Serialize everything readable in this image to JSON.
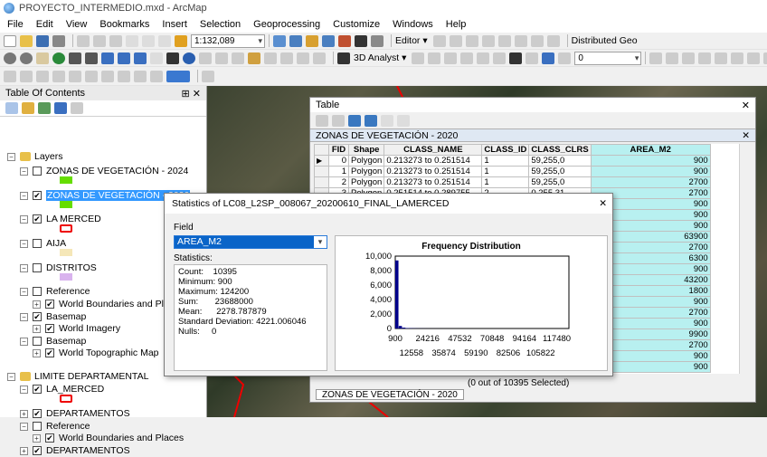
{
  "window": {
    "title": "PROYECTO_INTERMEDIO.mxd - ArcMap"
  },
  "menu": [
    "File",
    "Edit",
    "View",
    "Bookmarks",
    "Insert",
    "Selection",
    "Geoprocessing",
    "Customize",
    "Windows",
    "Help"
  ],
  "toolbar": {
    "scale": "1:132,089",
    "editor": "Editor ▾",
    "distributed": "Distributed Geo",
    "analyst": "3D Analyst ▾",
    "layer_combo_value": "0"
  },
  "toc": {
    "title": "Table Of Contents",
    "items": [
      {
        "label": "Layers",
        "level": 0,
        "pm": "−",
        "cb": false
      },
      {
        "label": "ZONAS DE VEGETACIÓN - 2024",
        "level": 1,
        "pm": "−",
        "cb": true,
        "checked": false
      },
      {
        "label": "ZONAS DE VEGETACIÓN - 2020",
        "level": 1,
        "pm": "−",
        "cb": true,
        "checked": true,
        "selected": true
      },
      {
        "label": "LA MERCED",
        "level": 1,
        "pm": "−",
        "cb": true,
        "checked": true
      },
      {
        "label": "AIJA",
        "level": 1,
        "pm": "−",
        "cb": true,
        "checked": false
      },
      {
        "label": "DISTRITOS",
        "level": 1,
        "pm": "−",
        "cb": true,
        "checked": false
      },
      {
        "label": "Reference",
        "level": 1,
        "pm": "−",
        "cb": true,
        "checked": false
      },
      {
        "label": "World Boundaries and Places",
        "level": 2,
        "pm": "+",
        "cb": true,
        "checked": true
      },
      {
        "label": "Basemap",
        "level": 1,
        "pm": "−",
        "cb": true,
        "checked": true
      },
      {
        "label": "World Imagery",
        "level": 2,
        "pm": "+",
        "cb": true,
        "checked": true
      },
      {
        "label": "Basemap",
        "level": 1,
        "pm": "−",
        "cb": true,
        "checked": false
      },
      {
        "label": "World Topographic Map",
        "level": 2,
        "pm": "+",
        "cb": true,
        "checked": true
      },
      {
        "label": "LIMITE DEPARTAMENTAL",
        "level": 0,
        "pm": "−",
        "cb": false
      },
      {
        "label": "LA_MERCED",
        "level": 1,
        "pm": "−",
        "cb": true,
        "checked": true
      },
      {
        "label": "DEPARTAMENTOS",
        "level": 1,
        "pm": "+",
        "cb": true,
        "checked": true
      },
      {
        "label": "Reference",
        "level": 1,
        "pm": "−",
        "cb": true,
        "checked": false
      },
      {
        "label": "World Boundaries and Places",
        "level": 2,
        "pm": "+",
        "cb": true,
        "checked": true
      },
      {
        "label": "DEPARTAMENTOS",
        "level": 1,
        "pm": "+",
        "cb": true,
        "checked": true
      }
    ]
  },
  "table": {
    "title": "Table",
    "layer_tab": "ZONAS DE VEGETACIÓN - 2020",
    "columns": [
      "",
      "FID",
      "Shape",
      "CLASS_NAME",
      "CLASS_ID",
      "CLASS_CLRS",
      "AREA_M2"
    ],
    "rows": [
      [
        "▶",
        "0",
        "Polygon",
        "0.213273 to 0.251514",
        "1",
        "59,255,0",
        "900"
      ],
      [
        "",
        "1",
        "Polygon",
        "0.213273 to 0.251514",
        "1",
        "59,255,0",
        "900"
      ],
      [
        "",
        "2",
        "Polygon",
        "0.213273 to 0.251514",
        "1",
        "59,255,0",
        "2700"
      ],
      [
        "",
        "3",
        "Polygon",
        "0.251514 to 0.289755",
        "2",
        "0,255,31",
        "2700"
      ],
      [
        "",
        "",
        "",
        "",
        "",
        "",
        "900"
      ],
      [
        "",
        "",
        "",
        "",
        "",
        "",
        "900"
      ],
      [
        "",
        "",
        "",
        "",
        "",
        "",
        "900"
      ],
      [
        "",
        "",
        "",
        "",
        "",
        "",
        "63900"
      ],
      [
        "",
        "",
        "",
        "",
        "",
        "",
        "2700"
      ],
      [
        "",
        "",
        "",
        "",
        "",
        "",
        "6300"
      ],
      [
        "",
        "",
        "",
        "",
        "",
        "",
        "900"
      ],
      [
        "",
        "",
        "",
        "",
        "",
        "",
        "43200"
      ],
      [
        "",
        "",
        "",
        "",
        "",
        "",
        "1800"
      ],
      [
        "",
        "",
        "",
        "",
        "",
        "",
        "900"
      ],
      [
        "",
        "",
        "",
        "",
        "",
        "",
        "2700"
      ],
      [
        "",
        "",
        "",
        "",
        "",
        "",
        "900"
      ],
      [
        "",
        "",
        "",
        "",
        "",
        "",
        "9900"
      ],
      [
        "",
        "",
        "",
        "",
        "",
        "",
        "2700"
      ],
      [
        "",
        "",
        "",
        "",
        "",
        "",
        "900"
      ],
      [
        "",
        "",
        "",
        "",
        "",
        "",
        "900"
      ]
    ],
    "status": "(0 out of 10395 Selected)",
    "bottom_tab": "ZONAS DE VEGETACIÓN - 2020"
  },
  "stats": {
    "title": "Statistics of LC08_L2SP_008067_20200610_FINAL_LAMERCED",
    "field_label": "Field",
    "field_value": "AREA_M2",
    "stats_label": "Statistics:",
    "lines": [
      "Count:    10395",
      "Minimum: 900",
      "Maximum: 124200",
      "Sum:       23688000",
      "Mean:      2278.787879",
      "Standard Deviation: 4221.006046",
      "Nulls:     0"
    ]
  },
  "chart_data": {
    "type": "bar",
    "title": "Frequency Distribution",
    "yticks": [
      "10,000",
      "8,000",
      "6,000",
      "4,000",
      "2,000",
      "0"
    ],
    "xticks_top": [
      "900",
      "24216",
      "47532",
      "70848",
      "94164",
      "117480"
    ],
    "xticks_bottom": [
      "12558",
      "35874",
      "59190",
      "82506",
      "105822"
    ],
    "ylim": [
      0,
      10000
    ],
    "values": [
      9400,
      350,
      120,
      60,
      40,
      30,
      20,
      15,
      10,
      8,
      6,
      5,
      4,
      3,
      3,
      2,
      2,
      2,
      1,
      1,
      1,
      1,
      1,
      1,
      1,
      1,
      1,
      1,
      1,
      1,
      1,
      1,
      1,
      1,
      1,
      1,
      1,
      1,
      1,
      1,
      1,
      1,
      1,
      1,
      1,
      1,
      1,
      1,
      1,
      1
    ],
    "color": "#00008b"
  },
  "colors": {
    "veg2024": "#66dd00",
    "veg2020": "#66dd00",
    "merced": "#ee0000",
    "aija": "#f5e7b8",
    "distritos": "#d9b3ee",
    "la_merced2": "#ee0000",
    "selected": "#3399ff",
    "area_col": "#b8f0f0"
  }
}
